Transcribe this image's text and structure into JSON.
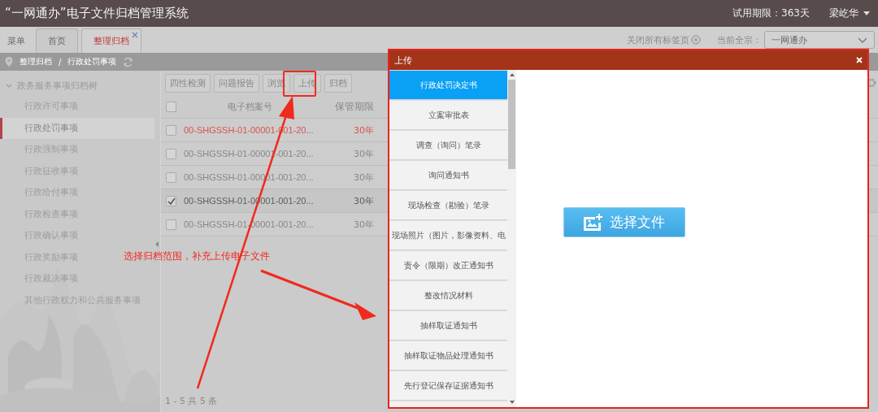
{
  "header": {
    "title": "“一网通办”电子文件归档管理系统",
    "trial": "试用期限：363天",
    "user": "梁屹华"
  },
  "tabs": [
    {
      "label": "菜单",
      "selected": false,
      "closable": false
    },
    {
      "label": "首页",
      "selected": false,
      "closable": false
    },
    {
      "label": "整理归档",
      "selected": true,
      "closable": true
    }
  ],
  "close_all": "关闭所有标签页",
  "fonds_label": "当前全宗：",
  "fonds_value": "一网通办",
  "breadcrumb": {
    "items": [
      "整理归档",
      "行政处罚事项"
    ],
    "separator": "/"
  },
  "tree": {
    "label": "政务服务事项归档树",
    "expanded": true,
    "children": [
      {
        "label": "行政许可事项",
        "selected": false
      },
      {
        "label": "行政处罚事项",
        "selected": true
      },
      {
        "label": "行政强制事项",
        "selected": false
      },
      {
        "label": "行政征收事项",
        "selected": false
      },
      {
        "label": "行政给付事项",
        "selected": false
      },
      {
        "label": "行政检查事项",
        "selected": false
      },
      {
        "label": "行政确认事项",
        "selected": false
      },
      {
        "label": "行政奖励事项",
        "selected": false
      },
      {
        "label": "行政裁决事项",
        "selected": false
      },
      {
        "label": "其他行政权力和公共服务事项",
        "selected": false
      }
    ]
  },
  "toolbar": [
    "四性检测",
    "问题报告",
    "浏览",
    "上传",
    "归档"
  ],
  "table": {
    "columns": [
      "电子档案号",
      "保管期限"
    ],
    "all_checked": false,
    "rows": [
      {
        "number": "00-SHGSSH-01-00001-001-20...",
        "period": "30年",
        "checked": false,
        "flagged": true
      },
      {
        "number": "00-SHGSSH-01-00001-001-20...",
        "period": "30年",
        "checked": false,
        "flagged": false
      },
      {
        "number": "00-SHGSSH-01-00001-001-20...",
        "period": "30年",
        "checked": false,
        "flagged": false
      },
      {
        "number": "00-SHGSSH-01-00001-001-20...",
        "period": "30年",
        "checked": true,
        "flagged": false
      },
      {
        "number": "00-SHGSSH-01-00001-001-20...",
        "period": "30年",
        "checked": false,
        "flagged": false
      }
    ]
  },
  "pagination": "1 - 5  共 5 条",
  "modal": {
    "title": "上传",
    "button": "选择文件",
    "items": [
      {
        "label": "行政处罚决定书",
        "selected": true
      },
      {
        "label": "立案审批表",
        "selected": false
      },
      {
        "label": "调查（询问）笔录",
        "selected": false
      },
      {
        "label": "询问通知书",
        "selected": false
      },
      {
        "label": "现场检查（勘验）笔录",
        "selected": false
      },
      {
        "label": "现场照片（图片，影像资料、电",
        "selected": false
      },
      {
        "label": "责令（限期）改正通知书",
        "selected": false
      },
      {
        "label": "整改情况材料",
        "selected": false
      },
      {
        "label": "抽样取证通知书",
        "selected": false
      },
      {
        "label": "抽样取证物品处理通知书",
        "selected": false
      },
      {
        "label": "先行登记保存证据通知书",
        "selected": false
      }
    ]
  },
  "annotation": {
    "text": "选择归档范围，补充上传电子文件"
  }
}
